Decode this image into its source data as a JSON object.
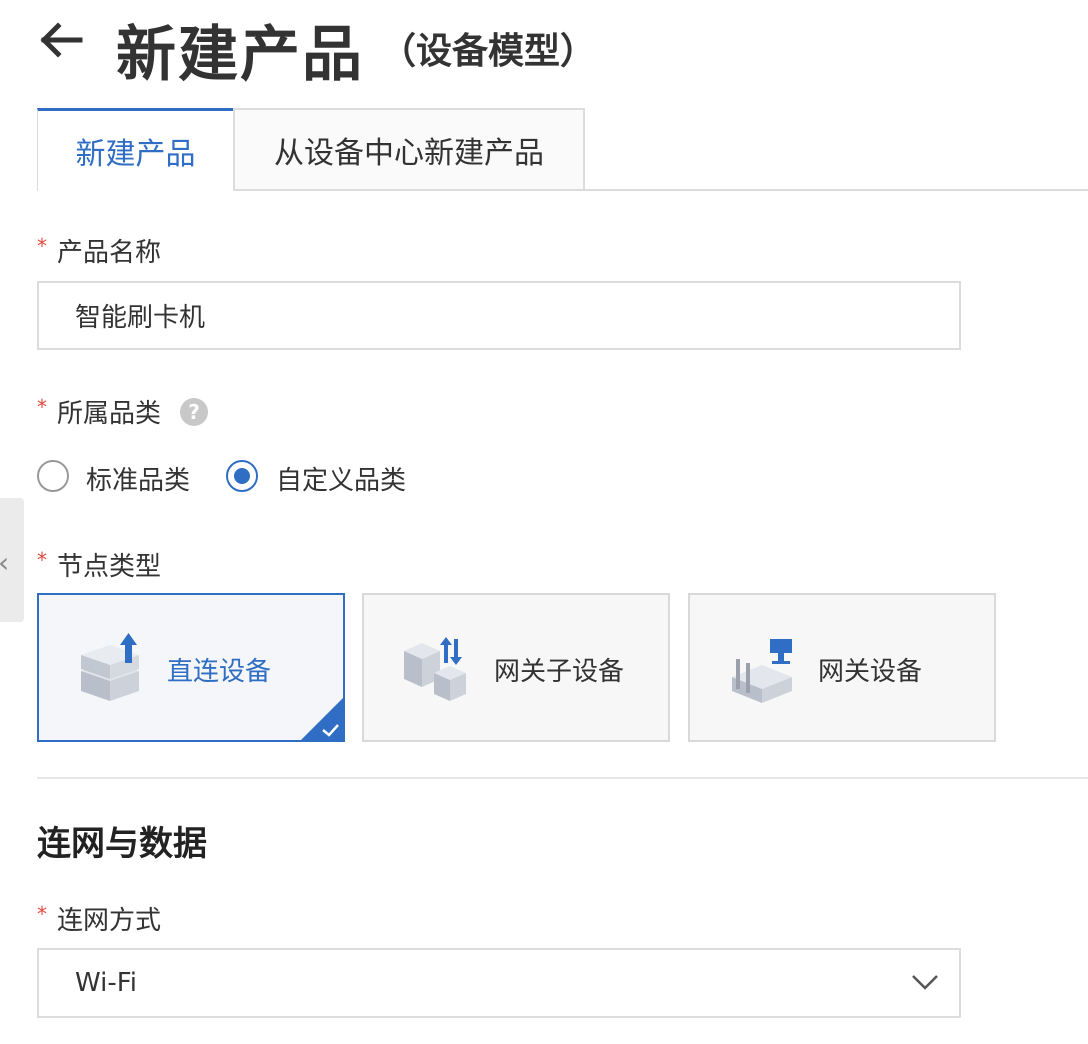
{
  "header": {
    "back_icon": "arrow-left-icon",
    "title": "新建产品",
    "subtitle": "（设备模型）"
  },
  "tabs": [
    {
      "label": "新建产品",
      "active": true
    },
    {
      "label": "从设备中心新建产品",
      "active": false
    }
  ],
  "form": {
    "required_mark": "*",
    "product_name": {
      "label": "产品名称",
      "value": "智能刷卡机"
    },
    "category": {
      "label": "所属品类",
      "help_icon": "question-circle-icon",
      "options": [
        {
          "label": "标准品类",
          "checked": false
        },
        {
          "label": "自定义品类",
          "checked": true
        }
      ]
    },
    "node_type": {
      "label": "节点类型",
      "cards": [
        {
          "label": "直连设备",
          "icon": "direct-device-icon",
          "selected": true
        },
        {
          "label": "网关子设备",
          "icon": "gateway-subdevice-icon",
          "selected": false
        },
        {
          "label": "网关设备",
          "icon": "gateway-device-icon",
          "selected": false
        }
      ]
    }
  },
  "network_section": {
    "title": "连网与数据",
    "connection": {
      "label": "连网方式",
      "value": "Wi-Fi"
    }
  },
  "colors": {
    "accent": "#2f6ec4",
    "required": "#e14a3b",
    "border": "#dcdcdc"
  }
}
